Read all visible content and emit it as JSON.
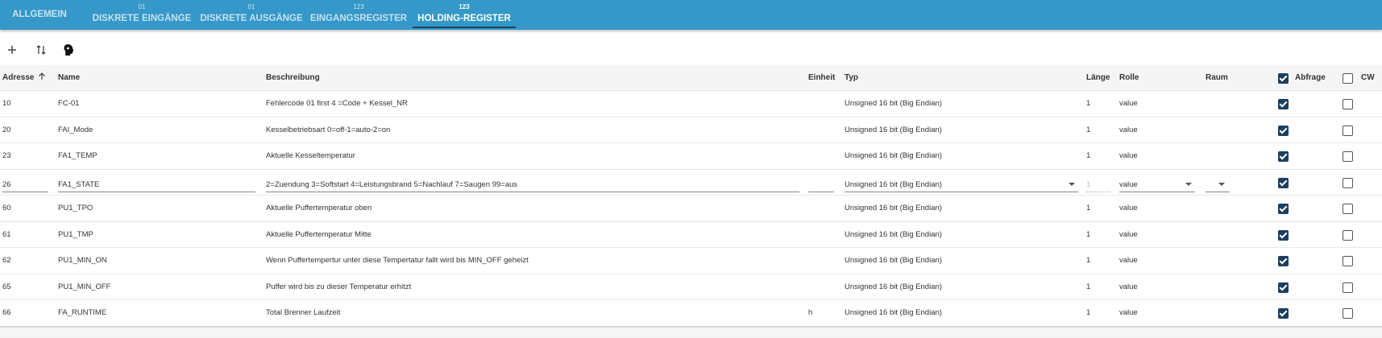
{
  "tabs": [
    {
      "label": "ALLGEMEIN",
      "sup": "",
      "active": false
    },
    {
      "label": "DISKRETE EINGÄNGE",
      "sup": "01",
      "active": false
    },
    {
      "label": "DISKRETE AUSGÄNGE",
      "sup": "01",
      "active": false
    },
    {
      "label": "EINGANGSREGISTER",
      "sup": "123",
      "active": false
    },
    {
      "label": "HOLDING-REGISTER",
      "sup": "123",
      "active": true
    }
  ],
  "toolbar": {
    "add_icon": "plus-icon",
    "sort_icon": "swap-vertical-icon",
    "head_icon": "head-profile-icon"
  },
  "columns": {
    "adresse": "Adresse",
    "name": "Name",
    "beschreibung": "Beschreibung",
    "einheit": "Einheit",
    "typ": "Typ",
    "laenge": "Länge",
    "rolle": "Rolle",
    "raum": "Raum",
    "abfrage": "Abfrage",
    "cw": "CW"
  },
  "header_checks": {
    "abfrage": true,
    "cw": false
  },
  "rows": [
    {
      "adresse": "10",
      "name": "FC-01",
      "beschreibung": "Fehlercode 01 first 4 =Code + Kessel_NR",
      "einheit": "",
      "typ": "Unsigned 16 bit (Big Endian)",
      "laenge": "1",
      "rolle": "value",
      "raum": "",
      "abfrage": true,
      "cw": false,
      "editing": false
    },
    {
      "adresse": "20",
      "name": "FAI_Mode",
      "beschreibung": "Kesselbetriebsart 0=off-1=auto-2=on",
      "einheit": "",
      "typ": "Unsigned 16 bit (Big Endian)",
      "laenge": "1",
      "rolle": "value",
      "raum": "",
      "abfrage": true,
      "cw": false,
      "editing": false
    },
    {
      "adresse": "23",
      "name": "FA1_TEMP",
      "beschreibung": "Aktuelle Kesseltemperatur",
      "einheit": "",
      "typ": "Unsigned 16 bit (Big Endian)",
      "laenge": "1",
      "rolle": "value",
      "raum": "",
      "abfrage": true,
      "cw": false,
      "editing": false
    },
    {
      "adresse": "26",
      "name": "FA1_STATE",
      "beschreibung": "2=Zuendung 3=Softstart 4=Leistungsbrand 5=Nachlauf 7=Saugen 99=aus",
      "einheit": "",
      "typ": "Unsigned 16 bit (Big Endian)",
      "laenge": "1",
      "rolle": "value",
      "raum": "",
      "abfrage": true,
      "cw": false,
      "editing": true
    },
    {
      "adresse": "60",
      "name": "PU1_TPO",
      "beschreibung": "Aktuelle Puffertemperatur oben",
      "einheit": "",
      "typ": "Unsigned 16 bit (Big Endian)",
      "laenge": "1",
      "rolle": "value",
      "raum": "",
      "abfrage": true,
      "cw": false,
      "editing": false
    },
    {
      "adresse": "61",
      "name": "PU1_TMP",
      "beschreibung": "Aktuelle Puffertemperatur Mitte",
      "einheit": "",
      "typ": "Unsigned 16 bit (Big Endian)",
      "laenge": "1",
      "rolle": "value",
      "raum": "",
      "abfrage": true,
      "cw": false,
      "editing": false
    },
    {
      "adresse": "62",
      "name": "PU1_MIN_ON",
      "beschreibung": "Wenn Puffertempertur unter diese Tempertatur fallt wird bis MIN_OFF geheizt",
      "einheit": "",
      "typ": "Unsigned 16 bit (Big Endian)",
      "laenge": "1",
      "rolle": "value",
      "raum": "",
      "abfrage": true,
      "cw": false,
      "editing": false
    },
    {
      "adresse": "65",
      "name": "PU1_MIN_OFF",
      "beschreibung": "Puffer wird bis zu dieser Temperatur erhitzt",
      "einheit": "",
      "typ": "Unsigned 16 bit (Big Endian)",
      "laenge": "1",
      "rolle": "value",
      "raum": "",
      "abfrage": true,
      "cw": false,
      "editing": false
    },
    {
      "adresse": "66",
      "name": "FA_RUNTIME",
      "beschreibung": "Total Brenner Laufzeit",
      "einheit": "h",
      "typ": "Unsigned 16 bit (Big Endian)",
      "laenge": "1",
      "rolle": "value",
      "raum": "",
      "abfrage": true,
      "cw": false,
      "editing": false
    }
  ],
  "colors": {
    "bar": "#3598c9",
    "check": "#1b3f60",
    "underline": "#16456a"
  }
}
